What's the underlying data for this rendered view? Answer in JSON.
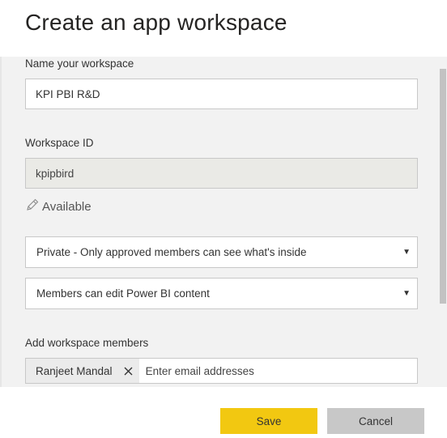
{
  "dialog": {
    "title": "Create an app workspace"
  },
  "form": {
    "name_label": "Name your workspace",
    "name_value": "KPI PBI R&D",
    "workspace_id_label": "Workspace ID",
    "workspace_id_value": "kpipbird",
    "availability_text": "Available",
    "privacy_select": {
      "selected": "Private - Only approved members can see what's inside"
    },
    "permission_select": {
      "selected": "Members can edit Power BI content"
    },
    "members_label": "Add workspace members",
    "members": [
      {
        "name": "Ranjeet Mandal"
      }
    ],
    "members_placeholder": "Enter email addresses"
  },
  "footer": {
    "save_label": "Save",
    "cancel_label": "Cancel"
  },
  "colors": {
    "save_button": "#f2c811",
    "cancel_button": "#c8c8c8",
    "panel_background": "#f2f2f2"
  },
  "icons": {
    "availability": "pencil-icon",
    "chip_remove": "close-icon",
    "select_caret": "caret-down-icon"
  }
}
